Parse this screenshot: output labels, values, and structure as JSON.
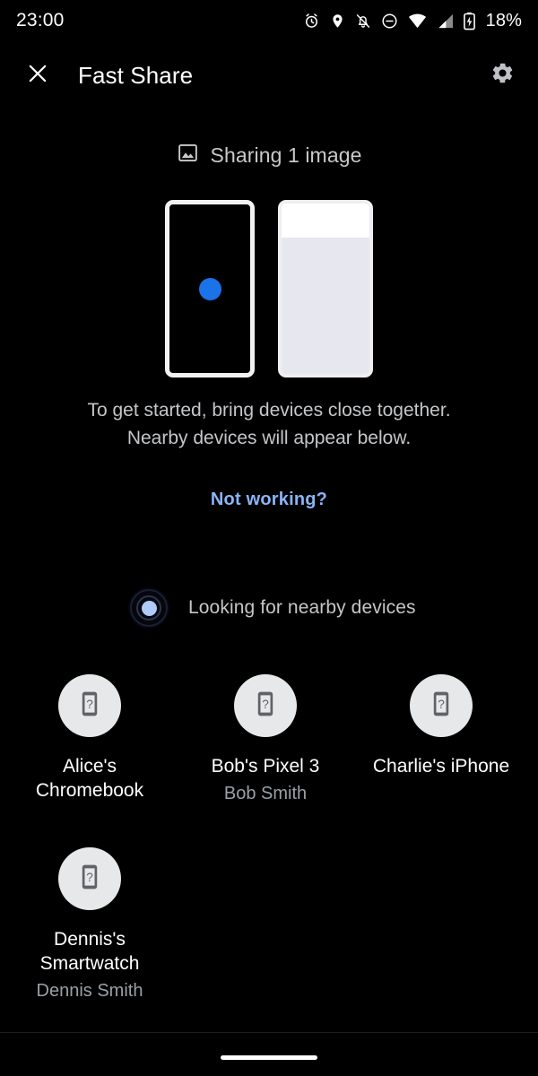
{
  "status_bar": {
    "time": "23:00",
    "battery_percent": "18%",
    "icons": [
      "alarm-icon",
      "location-icon",
      "notifications-off-icon",
      "do-not-disturb-icon",
      "wifi-icon",
      "cell-signal-icon",
      "battery-charging-icon"
    ]
  },
  "app_bar": {
    "close_icon": "close-icon",
    "title": "Fast Share",
    "settings_icon": "gear-icon"
  },
  "share_summary": {
    "icon": "image-icon",
    "label": "Sharing 1 image"
  },
  "illustration": {
    "left_device": "dark-phone-illustration",
    "right_device": "light-phone-illustration",
    "dot_color": "#1a73e8"
  },
  "instructions": {
    "line1": "To get started, bring devices close together.",
    "line2": "Nearby devices will appear below."
  },
  "help_link": {
    "label": "Not working?",
    "color": "#8ab4f8"
  },
  "scanning": {
    "icon": "radar-scan-icon",
    "label": "Looking for nearby devices",
    "accent_color": "#aecbfa"
  },
  "devices": [
    {
      "name": "Alice's Chromebook",
      "owner": "",
      "icon": "unknown-device-icon"
    },
    {
      "name": "Bob's Pixel 3",
      "owner": "Bob Smith",
      "icon": "unknown-device-icon"
    },
    {
      "name": "Charlie's iPhone",
      "owner": "",
      "icon": "unknown-device-icon"
    },
    {
      "name": "Dennis's Smartwatch",
      "owner": "Dennis Smith",
      "icon": "unknown-device-icon"
    }
  ],
  "nav_bar": {
    "home_pill": "home-gesture-pill"
  }
}
